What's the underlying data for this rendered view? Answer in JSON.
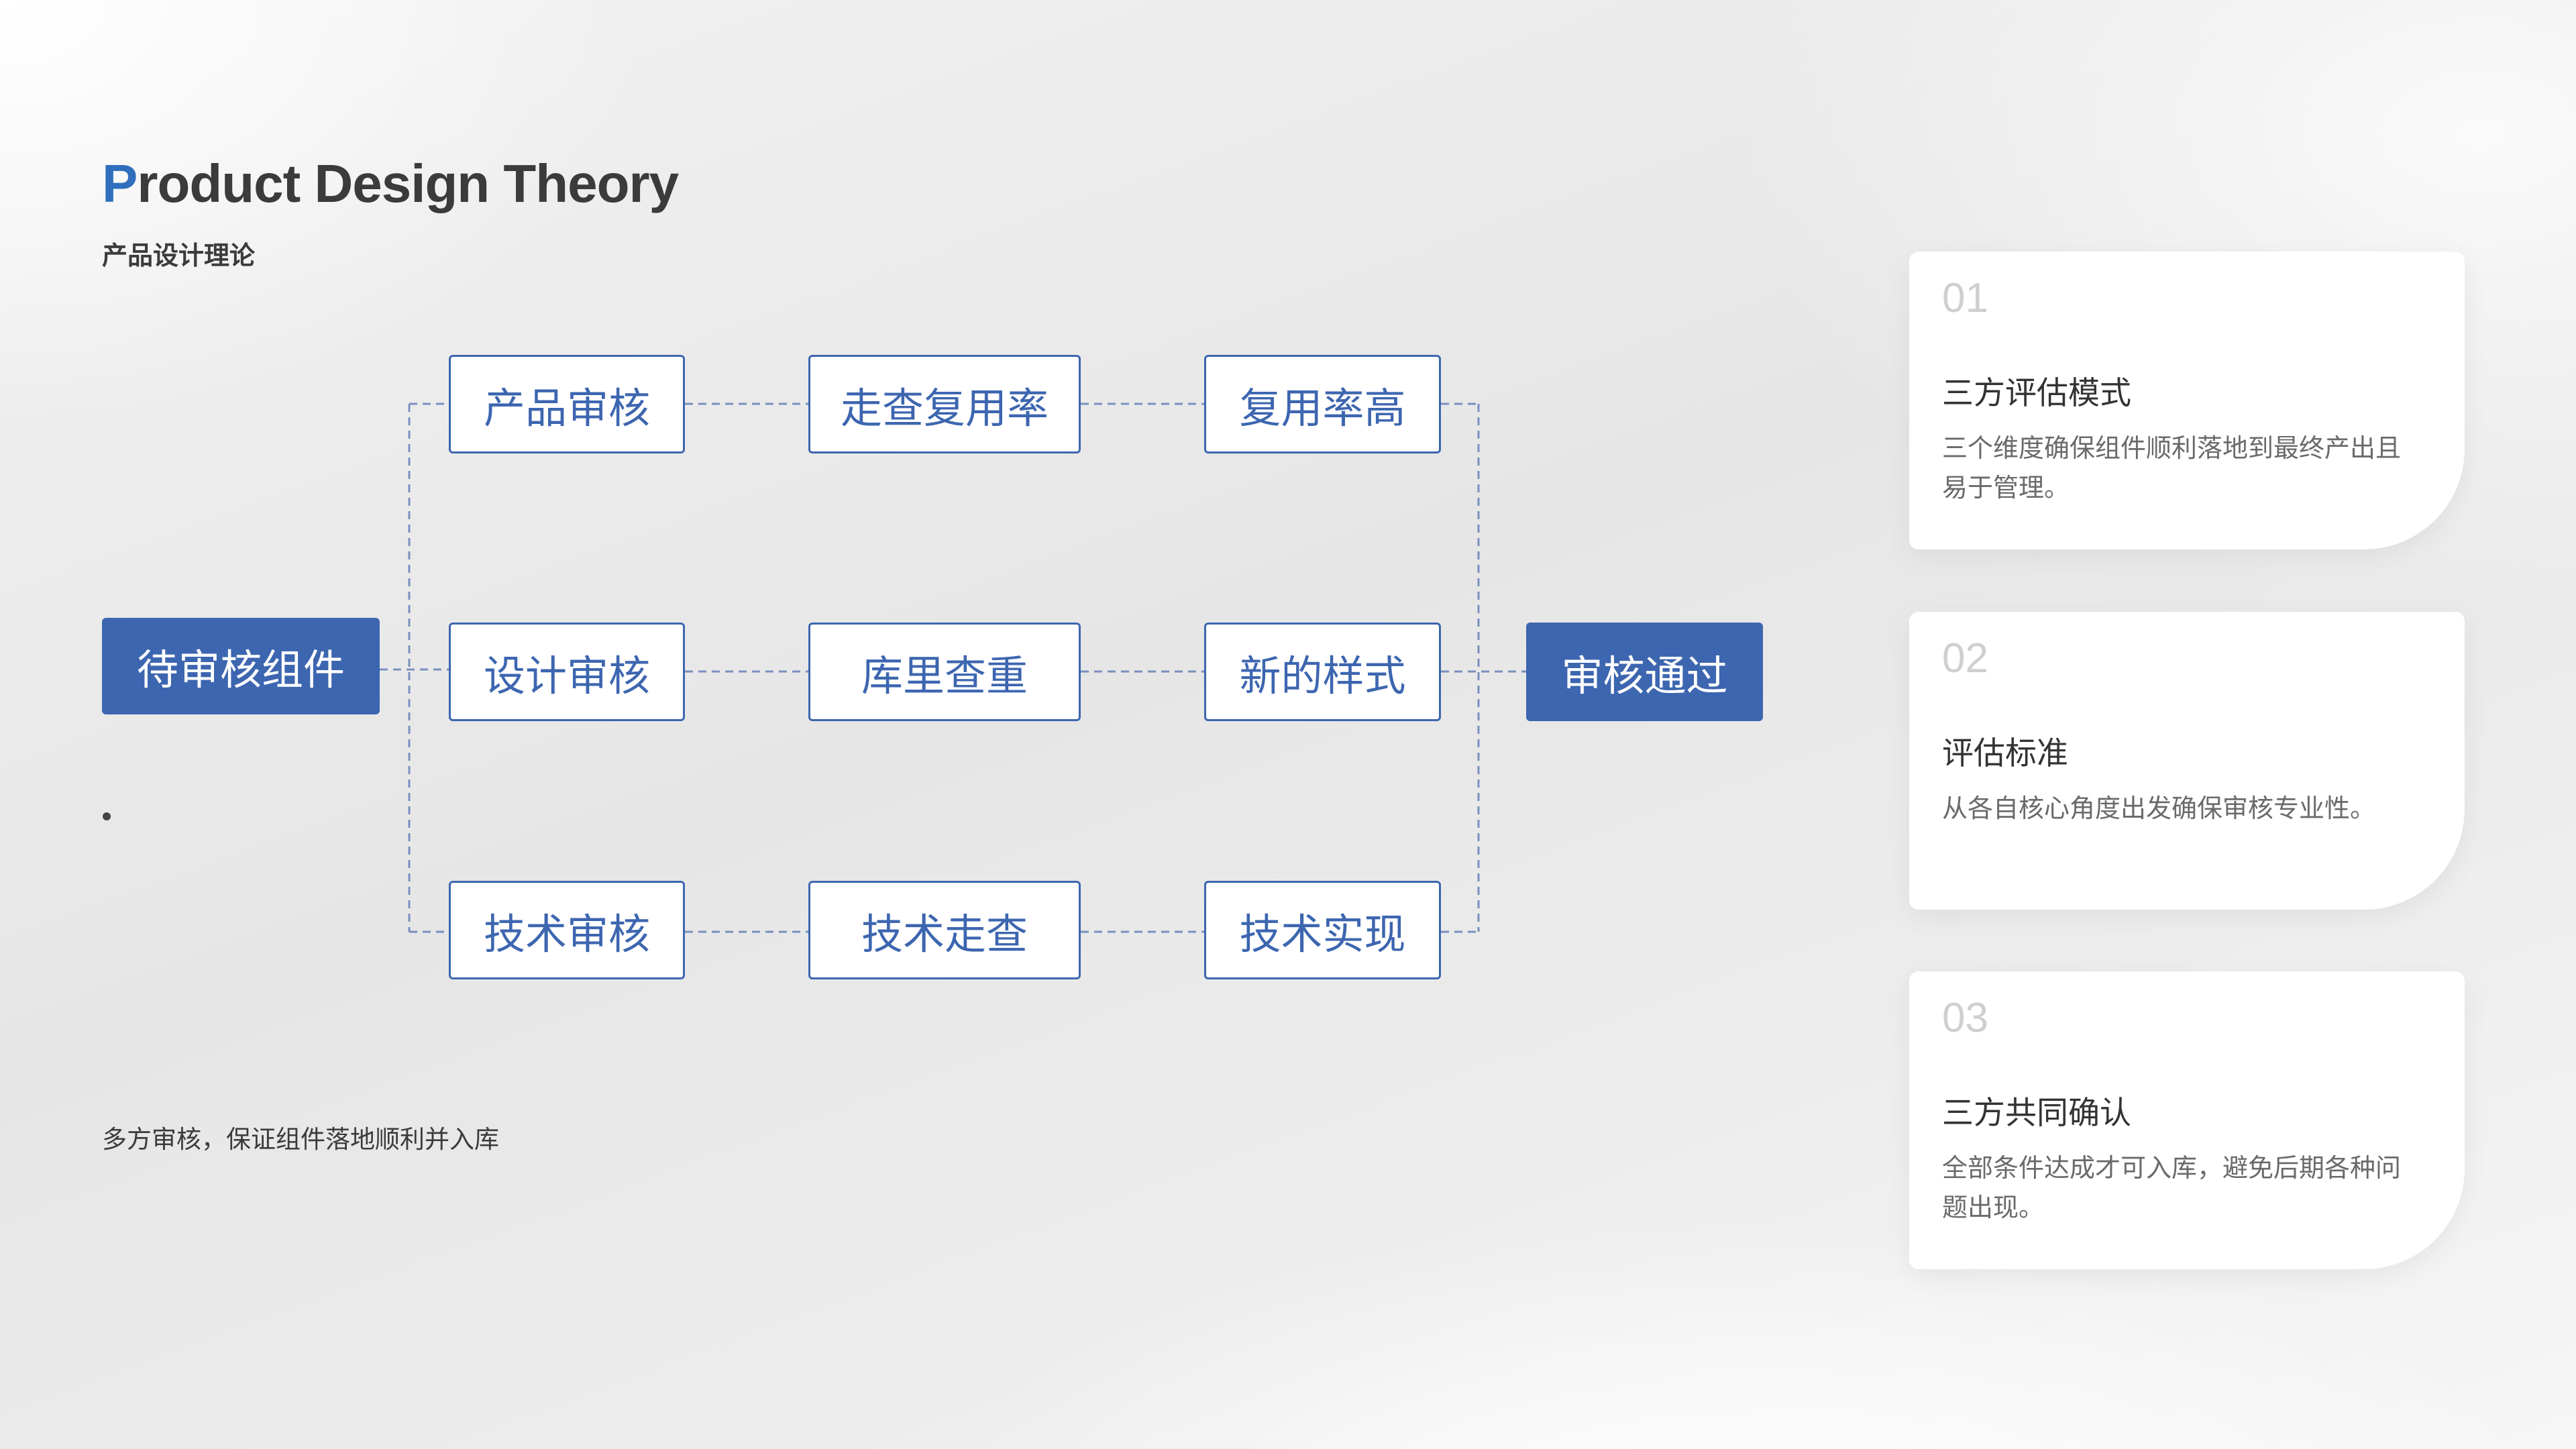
{
  "header": {
    "title_first_letter": "P",
    "title_rest": "roduct Design Theory",
    "subtitle": "产品设计理论"
  },
  "flow": {
    "start": "待审核组件",
    "end": "审核通过",
    "rows": [
      [
        "产品审核",
        "走查复用率",
        "复用率高"
      ],
      [
        "设计审核",
        "库里查重",
        "新的样式"
      ],
      [
        "技术审核",
        "技术走查",
        "技术实现"
      ]
    ]
  },
  "footer_text": "多方审核，保证组件落地顺利并入库",
  "cards": [
    {
      "number": "01",
      "title": "三方评估模式",
      "desc": "三个维度确保组件顺利落地到最终产出且易于管理。"
    },
    {
      "number": "02",
      "title": "评估标准",
      "desc": "从各自核心角度出发确保审核专业性。"
    },
    {
      "number": "03",
      "title": "三方共同确认",
      "desc": "全部条件达成才可入库，避免后期各种问题出现。"
    }
  ],
  "colors": {
    "accent": "#3d66b0",
    "title_accent": "#2f6fbd",
    "text": "#3b3b3b"
  }
}
